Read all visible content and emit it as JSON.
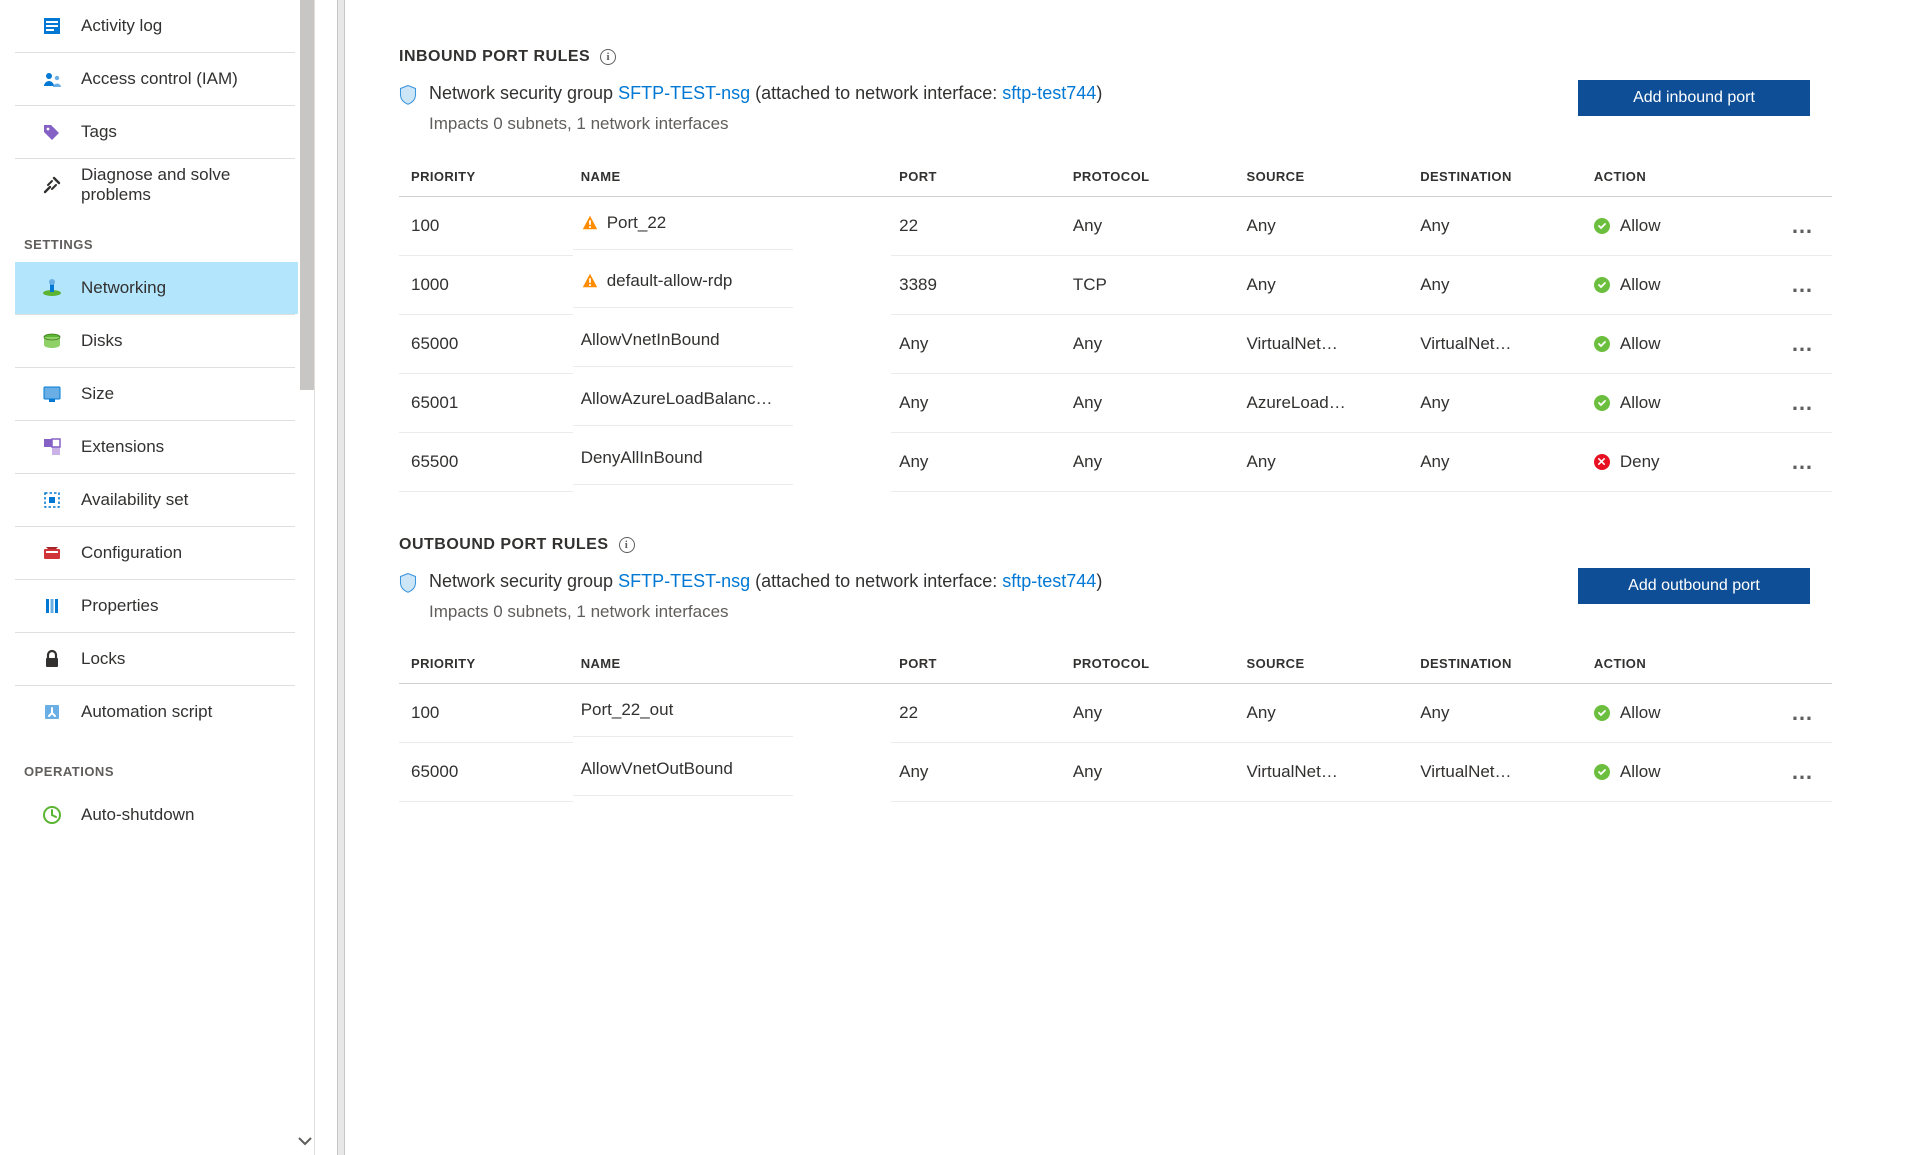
{
  "sidebar": {
    "top": [
      {
        "label": "Activity log",
        "icon": "activity-log-icon"
      },
      {
        "label": "Access control (IAM)",
        "icon": "access-control-icon"
      },
      {
        "label": "Tags",
        "icon": "tags-icon"
      },
      {
        "label": "Diagnose and solve problems",
        "icon": "diagnose-icon"
      }
    ],
    "settings_header": "SETTINGS",
    "settings": [
      {
        "label": "Networking",
        "icon": "networking-icon",
        "selected": true
      },
      {
        "label": "Disks",
        "icon": "disks-icon"
      },
      {
        "label": "Size",
        "icon": "size-icon"
      },
      {
        "label": "Extensions",
        "icon": "extensions-icon"
      },
      {
        "label": "Availability set",
        "icon": "availability-set-icon"
      },
      {
        "label": "Configuration",
        "icon": "configuration-icon"
      },
      {
        "label": "Properties",
        "icon": "properties-icon"
      },
      {
        "label": "Locks",
        "icon": "locks-icon"
      },
      {
        "label": "Automation script",
        "icon": "automation-script-icon"
      }
    ],
    "operations_header": "OPERATIONS",
    "operations": [
      {
        "label": "Auto-shutdown",
        "icon": "auto-shutdown-icon"
      }
    ]
  },
  "inbound": {
    "title": "INBOUND PORT RULES",
    "nsg_prefix": "Network security group ",
    "nsg_link": "SFTP-TEST-nsg",
    "nsg_mid": " (attached to network interface: ",
    "nic_link": "sftp-test744",
    "nsg_suffix": ")",
    "impacts": "Impacts 0 subnets, 1 network interfaces",
    "add_button": "Add inbound port",
    "columns": [
      "PRIORITY",
      "NAME",
      "PORT",
      "PROTOCOL",
      "SOURCE",
      "DESTINATION",
      "ACTION"
    ],
    "rows": [
      {
        "priority": "100",
        "name": "Port_22",
        "warn": true,
        "port": "22",
        "protocol": "Any",
        "source": "Any",
        "destination": "Any",
        "action": "Allow",
        "status": "allow"
      },
      {
        "priority": "1000",
        "name": "default-allow-rdp",
        "warn": true,
        "port": "3389",
        "protocol": "TCP",
        "source": "Any",
        "destination": "Any",
        "action": "Allow",
        "status": "allow"
      },
      {
        "priority": "65000",
        "name": "AllowVnetInBound",
        "warn": false,
        "port": "Any",
        "protocol": "Any",
        "source": "VirtualNet…",
        "destination": "VirtualNet…",
        "action": "Allow",
        "status": "allow"
      },
      {
        "priority": "65001",
        "name": "AllowAzureLoadBalanc…",
        "warn": false,
        "port": "Any",
        "protocol": "Any",
        "source": "AzureLoad…",
        "destination": "Any",
        "action": "Allow",
        "status": "allow"
      },
      {
        "priority": "65500",
        "name": "DenyAllInBound",
        "warn": false,
        "port": "Any",
        "protocol": "Any",
        "source": "Any",
        "destination": "Any",
        "action": "Deny",
        "status": "deny"
      }
    ]
  },
  "outbound": {
    "title": "OUTBOUND PORT RULES",
    "nsg_prefix": "Network security group ",
    "nsg_link": "SFTP-TEST-nsg",
    "nsg_mid": " (attached to network interface: ",
    "nic_link": "sftp-test744",
    "nsg_suffix": ")",
    "impacts": "Impacts 0 subnets, 1 network interfaces",
    "add_button": "Add outbound port",
    "columns": [
      "PRIORITY",
      "NAME",
      "PORT",
      "PROTOCOL",
      "SOURCE",
      "DESTINATION",
      "ACTION"
    ],
    "rows": [
      {
        "priority": "100",
        "name": "Port_22_out",
        "warn": false,
        "port": "22",
        "protocol": "Any",
        "source": "Any",
        "destination": "Any",
        "action": "Allow",
        "status": "allow"
      },
      {
        "priority": "65000",
        "name": "AllowVnetOutBound",
        "warn": false,
        "port": "Any",
        "protocol": "Any",
        "source": "VirtualNet…",
        "destination": "VirtualNet…",
        "action": "Allow",
        "status": "allow"
      }
    ]
  }
}
